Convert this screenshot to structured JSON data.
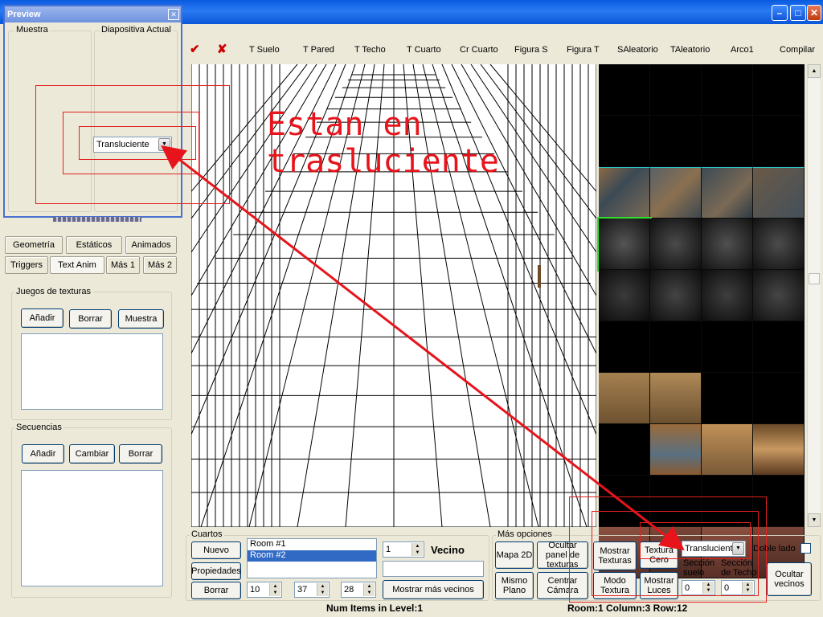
{
  "toolbar": {
    "check": "✔",
    "cross": "✘",
    "items": [
      "T Suelo",
      "T Pared",
      "T Techo",
      "T Cuarto",
      "Cr Cuarto",
      "Figura S",
      "Figura T",
      "SAleatorio",
      "TAleatorio",
      "Arco1",
      "Compilar"
    ]
  },
  "preview": {
    "title": "Preview",
    "close": "✕",
    "muestra": "Muestra",
    "diapositiva": "Diapositiva Actual",
    "mode": "Transluciente"
  },
  "annotation": {
    "line1": "Estan en",
    "line2": "trasluciente"
  },
  "tabs": {
    "row1": [
      "Geometría",
      "Estáticos",
      "Animados"
    ],
    "row2": [
      "Triggers",
      "Text Anim",
      "Más 1",
      "Más 2"
    ]
  },
  "juegos": {
    "title": "Juegos de texturas",
    "add": "Añadir",
    "del": "Borrar",
    "show": "Muestra"
  },
  "secuencias": {
    "title": "Secuencias",
    "add": "Añadir",
    "change": "Cambiar",
    "del": "Borrar"
  },
  "cuartos": {
    "title": "Cuartos",
    "new": "Nuevo",
    "props": "Propiedades",
    "del": "Borrar",
    "rooms": [
      "Room #1",
      "Room #2"
    ],
    "neighbor_value": "1",
    "neighbor_label": "Vecino",
    "x": "10",
    "y": "37",
    "z": "28",
    "more_neighbors": "Mostrar más vecinos"
  },
  "mas": {
    "title": "Más opciones",
    "map2d": "Mapa 2D",
    "hide_panel": "Ocultar panel de texturas",
    "show_tex": "Mostrar Texturas",
    "tex_zero": "Textura Cero",
    "trans_mode": "Transluciente",
    "double_side": "Doble lado",
    "same_plane": "Mismo Plano",
    "center_cam": "Centrar Cámara",
    "tex_mode": "Modo Textura",
    "show_lights": "Mostrar Luces",
    "floor_sec": "Sección suelo",
    "ceil_sec": "Sección de Techo",
    "floor_val": "0",
    "ceil_val": "0",
    "hide_neighbors": "Ocultar vecinos"
  },
  "status": {
    "items": "Num Items in Level:1",
    "pos": "Room:1 Column:3 Row:12"
  }
}
